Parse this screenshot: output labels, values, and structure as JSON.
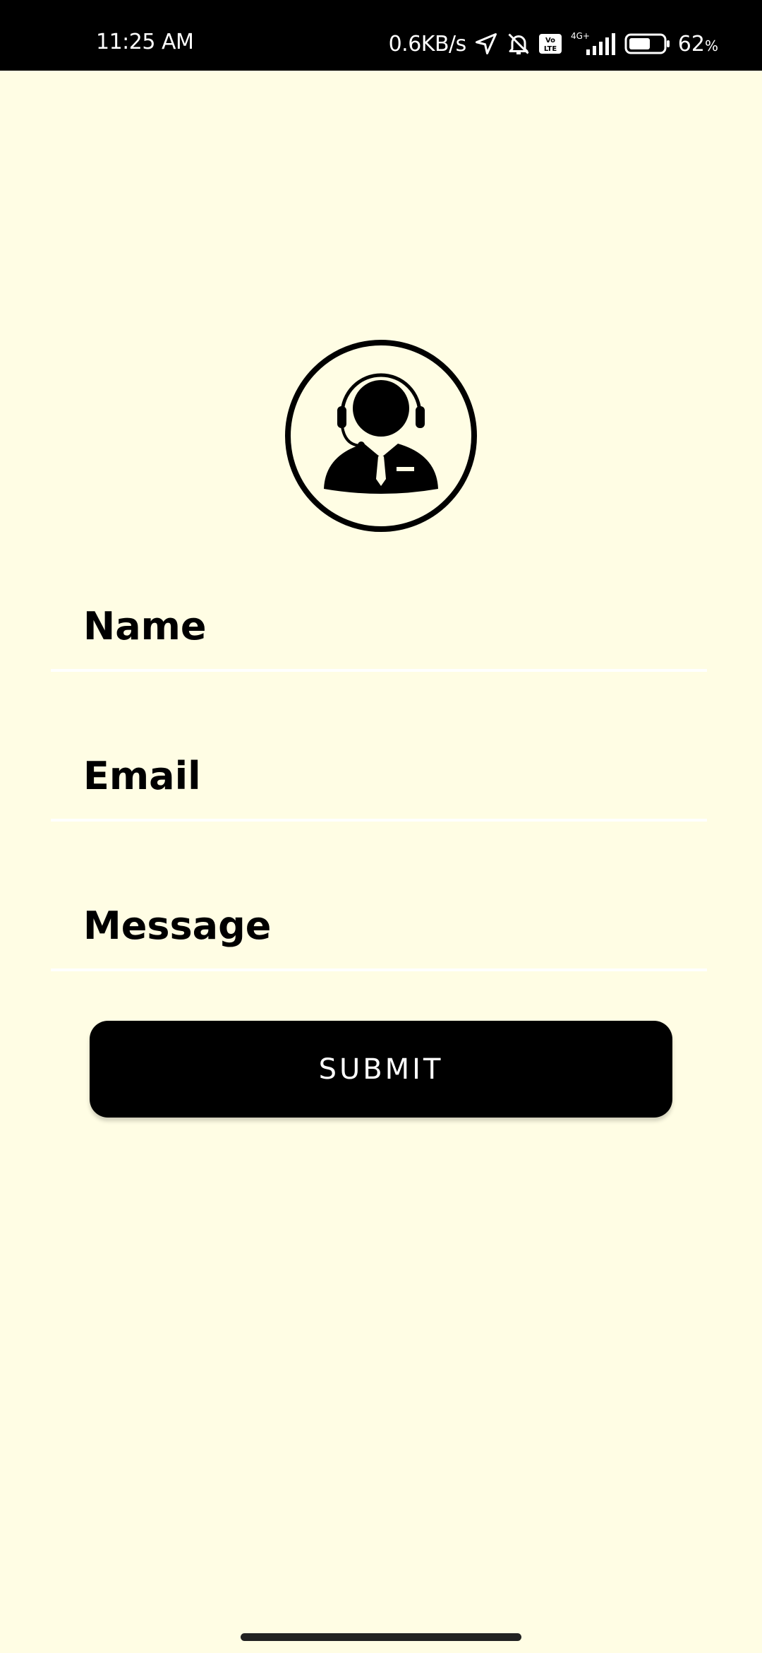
{
  "status_bar": {
    "time": "11:25 AM",
    "net_speed": "0.6KB/s",
    "network": "4G+",
    "volte": "Vo LTE",
    "battery_percent": "62",
    "battery_unit": "%",
    "battery_level": 0.62,
    "icons": [
      "location-arrow-icon",
      "bell-off-icon",
      "volte-icon",
      "signal-icon",
      "battery-icon"
    ]
  },
  "avatar": {
    "icon": "customer-support-agent-icon"
  },
  "form": {
    "name_placeholder": "Name",
    "email_placeholder": "Email",
    "message_placeholder": "Message",
    "submit_label": "SUBMIT"
  },
  "colors": {
    "background": "#fffde4",
    "button": "#000000",
    "button_text": "#ffffff"
  }
}
